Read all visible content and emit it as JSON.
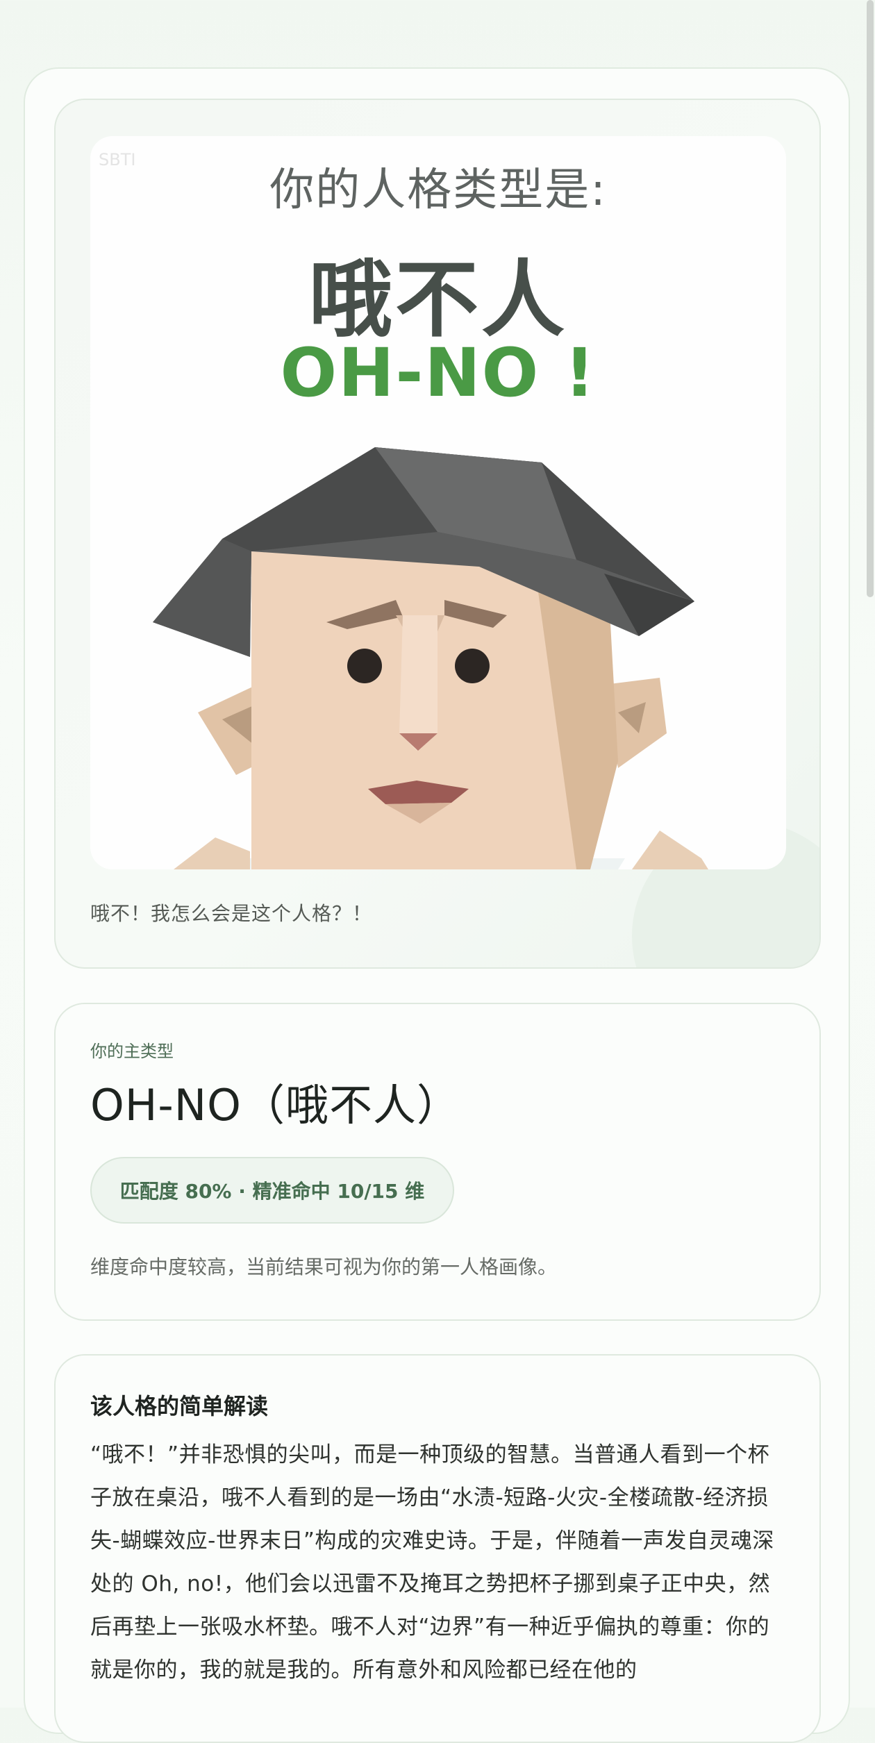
{
  "hero": {
    "image": {
      "heading": "你的人格类型是:",
      "type_name_cn": "哦不人",
      "type_name_en": "OH-NO !",
      "watermark": "SBTI"
    },
    "caption": "哦不！我怎么会是这个人格？！"
  },
  "result": {
    "eyebrow": "你的主类型",
    "title": "OH-NO（哦不人）",
    "badge": "匹配度 80% · 精准命中 10/15 维",
    "note": "维度命中度较高，当前结果可视为你的第一人格画像。"
  },
  "interpretation": {
    "heading": "该人格的简单解读",
    "body": "“哦不！”并非恐惧的尖叫，而是一种顶级的智慧。当普通人看到一个杯子放在桌沿，哦不人看到的是一场由“水渍-短路-火灾-全楼疏散-经济损失-蝴蝶效应-世界末日”构成的灾难史诗。于是，伴随着一声发自灵魂深处的 Oh, no!，他们会以迅雷不及掩耳之势把杯子挪到桌子正中央，然后再垫上一张吸水杯垫。哦不人对“边界”有一种近乎偏执的尊重：你的就是你的，我的就是我的。所有意外和风险都已经在他的"
  },
  "colors": {
    "accent_green": "#4a9a45",
    "badge_text": "#466e50",
    "badge_bg": "#eef5ef"
  }
}
